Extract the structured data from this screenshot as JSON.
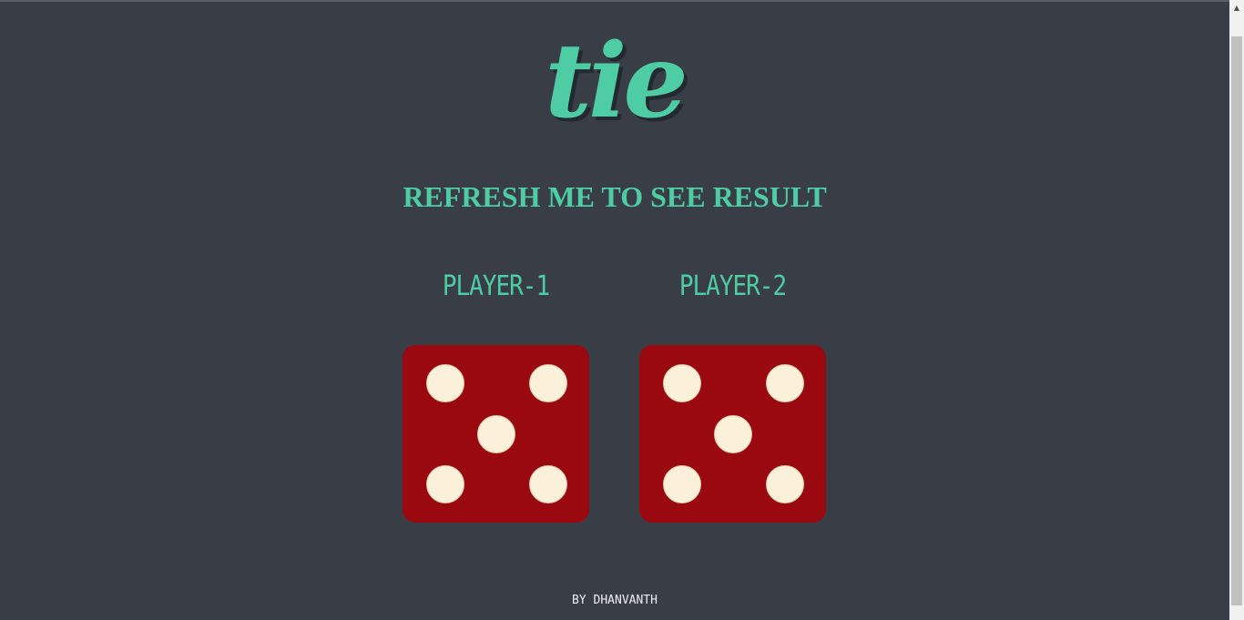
{
  "logo": {
    "text": "tie"
  },
  "headline": "REFRESH ME TO SEE RESULT",
  "players": [
    {
      "label": "PLAYER-1",
      "die_value": 5
    },
    {
      "label": "PLAYER-2",
      "die_value": 5
    }
  ],
  "footer": "BY DHANVANTH",
  "colors": {
    "background": "#393e46",
    "accent": "#4ecca3",
    "die": "#9a0810",
    "pip": "#fbf0d9",
    "footer_text": "#eeeeee"
  },
  "scrollbar": {
    "up_icon": "triangle-up-icon"
  }
}
